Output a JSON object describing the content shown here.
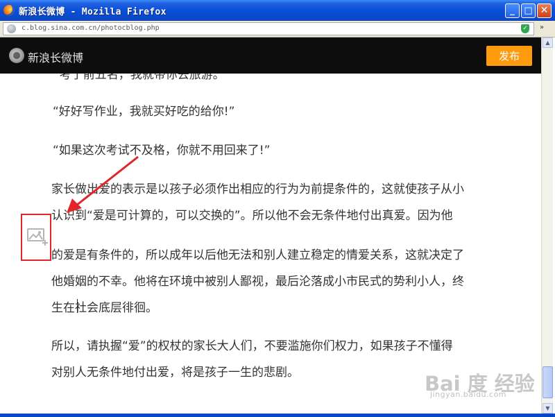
{
  "window": {
    "title": "新浪长微博 - Mozilla Firefox",
    "minimize_glyph": "_",
    "maximize_glyph": "□",
    "close_glyph": "✕"
  },
  "address_bar": {
    "url": "c.blog.sina.com.cn/photocblog.php",
    "overflow_glyph": "»"
  },
  "header": {
    "site_name": "新浪长微博",
    "publish_label": "发布"
  },
  "article": {
    "paragraphs": [
      [
        "“考了前五名，我就带你去旅游。”"
      ],
      [
        "“好好写作业，我就买好吃的给你!”"
      ],
      [
        "“如果这次考试不及格，你就不用回来了!”"
      ],
      [
        "家长做出爱的表示是以孩子必须作出相应的行为为前提条件的，这就使孩子从小",
        "认识到“爱是可计算的，可以交换的”。所以他不会无条件地付出真爱。因为他",
        "的爱是有条件的，所以成年以后他无法和别人建立稳定的情爱关系，这就决定了",
        "他婚姻的不幸。他将在环境中被别人鄙视，最后沦落成小市民式的势利小人，终",
        "生在社会底层徘徊。"
      ],
      [
        "所以，请执握“爱”的权杖的家长大人们，不要滥施你们权力，如果孩子不懂得",
        "对别人无条件地付出爱，将是孩子一生的悲剧。"
      ]
    ]
  },
  "watermark": {
    "text": "Bai 度 经验",
    "url": "jingyan.baidu.com"
  },
  "icons": {
    "browser": "firefox-icon",
    "site": "globe-icon",
    "security": "shield-icon",
    "logo": "sina-eye-icon",
    "insert_image": "image-add-icon"
  },
  "colors": {
    "publish_button": "#ff9b0f",
    "header_bg": "#0d0d0d",
    "annotation": "#e0242a",
    "text": "#333333"
  }
}
